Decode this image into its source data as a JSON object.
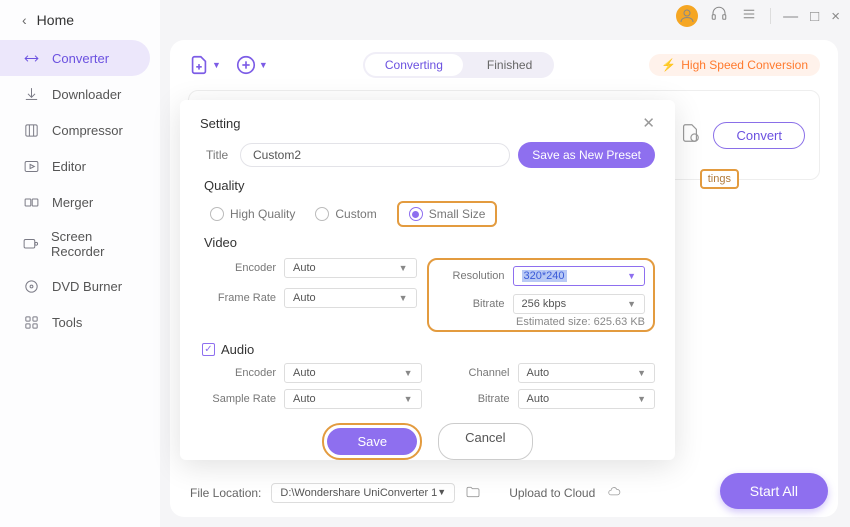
{
  "titlebar": {
    "min": "—",
    "max": "□",
    "close": "×"
  },
  "sidebar": {
    "home": "Home",
    "items": [
      {
        "label": "Converter"
      },
      {
        "label": "Downloader"
      },
      {
        "label": "Compressor"
      },
      {
        "label": "Editor"
      },
      {
        "label": "Merger"
      },
      {
        "label": "Screen Recorder"
      },
      {
        "label": "DVD Burner"
      },
      {
        "label": "Tools"
      }
    ]
  },
  "toggle": {
    "converting": "Converting",
    "finished": "Finished"
  },
  "hs_badge": "High Speed Conversion",
  "filecard": {
    "convert": "Convert",
    "settings_tag": "tings"
  },
  "bottom": {
    "file_location_label": "File Location:",
    "file_location_value": "D:\\Wondershare UniConverter 1",
    "upload_label": "Upload to Cloud",
    "start_all": "Start All"
  },
  "modal": {
    "header": "Setting",
    "title_label": "Title",
    "title_value": "Custom2",
    "save_preset": "Save as New Preset",
    "quality_header": "Quality",
    "quality": {
      "hq": "High Quality",
      "custom": "Custom",
      "small": "Small Size"
    },
    "video_header": "Video",
    "video": {
      "encoder_label": "Encoder",
      "encoder_value": "Auto",
      "framerate_label": "Frame Rate",
      "framerate_value": "Auto",
      "resolution_label": "Resolution",
      "resolution_value": "320*240",
      "bitrate_label": "Bitrate",
      "bitrate_value": "256 kbps",
      "estimated": "Estimated size: 625.63 KB"
    },
    "audio_header": "Audio",
    "audio": {
      "encoder_label": "Encoder",
      "encoder_value": "Auto",
      "samplerate_label": "Sample Rate",
      "samplerate_value": "Auto",
      "channel_label": "Channel",
      "channel_value": "Auto",
      "bitrate_label": "Bitrate",
      "bitrate_value": "Auto"
    },
    "save": "Save",
    "cancel": "Cancel"
  }
}
